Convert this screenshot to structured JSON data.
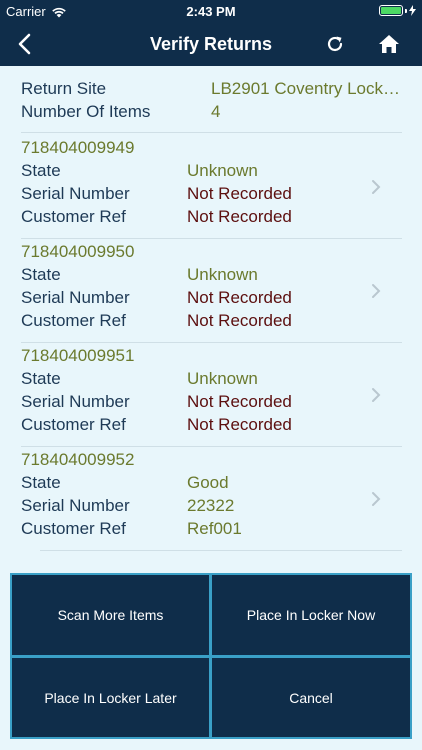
{
  "status": {
    "carrier": "Carrier",
    "time": "2:43 PM"
  },
  "nav": {
    "title": "Verify Returns"
  },
  "summary": {
    "return_site_label": "Return Site",
    "return_site_value": "LB2901 Coventry Lock…",
    "items_label": "Number Of Items",
    "items_value": "4"
  },
  "items": [
    {
      "id": "718404009949",
      "state_label": "State",
      "state": "Unknown",
      "serial_label": "Serial Number",
      "serial": "Not Recorded",
      "ref_label": "Customer Ref",
      "ref": "Not Recorded"
    },
    {
      "id": "718404009950",
      "state_label": "State",
      "state": "Unknown",
      "serial_label": "Serial Number",
      "serial": "Not Recorded",
      "ref_label": "Customer Ref",
      "ref": "Not Recorded"
    },
    {
      "id": "718404009951",
      "state_label": "State",
      "state": "Unknown",
      "serial_label": "Serial Number",
      "serial": "Not Recorded",
      "ref_label": "Customer Ref",
      "ref": "Not Recorded"
    },
    {
      "id": "718404009952",
      "state_label": "State",
      "state": "Good",
      "serial_label": "Serial Number",
      "serial": "22322",
      "ref_label": "Customer Ref",
      "ref": "Ref001"
    }
  ],
  "actions": {
    "scan_more": "Scan More Items",
    "place_now": "Place In Locker Now",
    "place_later": "Place In Locker Later",
    "cancel": "Cancel"
  },
  "colors": {
    "nav_bg": "#0f2d4a",
    "page_bg": "#e8f6fb",
    "accent_border": "#3aa0c7",
    "value_green": "#6b7a2e",
    "value_red": "#5c0f0f"
  },
  "icons": [
    "wifi-icon",
    "battery-icon",
    "back-arrow-icon",
    "refresh-icon",
    "home-icon",
    "chevron-right-icon"
  ]
}
